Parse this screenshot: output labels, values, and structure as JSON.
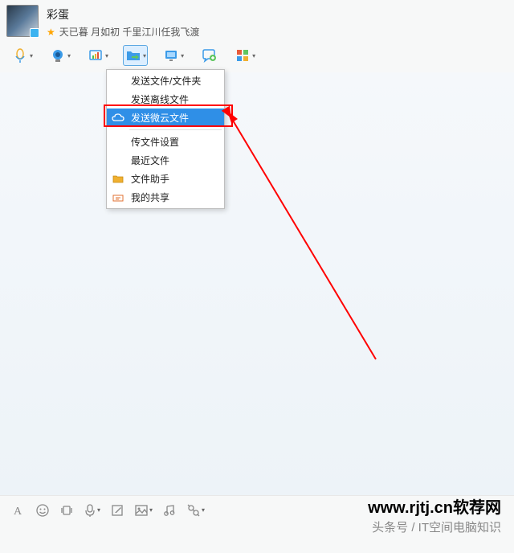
{
  "header": {
    "nickname": "彩蛋",
    "signature": "天已暮 月如初 千里江川任我飞渡"
  },
  "dropdown": {
    "items": [
      {
        "label": "发送文件/文件夹",
        "icon": ""
      },
      {
        "label": "发送离线文件",
        "icon": ""
      },
      {
        "label": "发送微云文件",
        "icon": "cloud",
        "selected": true
      },
      {
        "sep": true
      },
      {
        "label": "传文件设置",
        "icon": ""
      },
      {
        "label": "最近文件",
        "icon": ""
      },
      {
        "label": "文件助手",
        "icon": "folder"
      },
      {
        "label": "我的共享",
        "icon": "share"
      }
    ]
  },
  "watermark": {
    "line1": "www.rjtj.cn软荐网",
    "line2": "头条号 / IT空间电脑知识"
  }
}
